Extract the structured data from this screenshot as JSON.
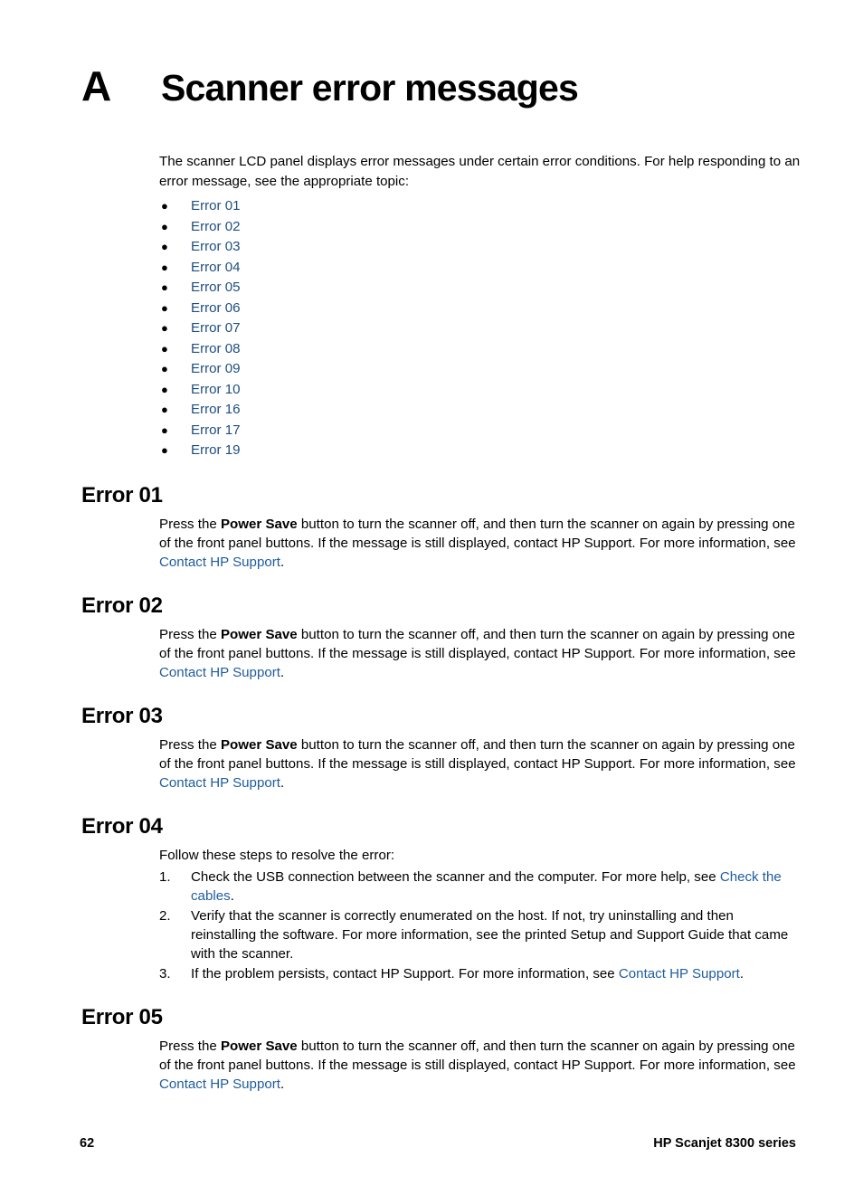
{
  "chapter": {
    "letter": "A",
    "title": "Scanner error messages"
  },
  "intro": "The scanner LCD panel displays error messages under certain error conditions. For help responding to an error message, see the appropriate topic:",
  "toc": {
    "bullet_glyph": "●",
    "items": [
      {
        "label": "Error 01"
      },
      {
        "label": "Error 02"
      },
      {
        "label": "Error 03"
      },
      {
        "label": "Error 04"
      },
      {
        "label": "Error 05"
      },
      {
        "label": "Error 06"
      },
      {
        "label": "Error 07"
      },
      {
        "label": "Error 08"
      },
      {
        "label": "Error 09"
      },
      {
        "label": "Error 10"
      },
      {
        "label": "Error 16"
      },
      {
        "label": "Error 17"
      },
      {
        "label": "Error 19"
      }
    ]
  },
  "sections": [
    {
      "heading": "Error 01",
      "para_lead": "Press the ",
      "para_bold": "Power Save",
      "para_mid": " button to turn the scanner off, and then turn the scanner on again by pressing one of the front panel buttons. If the message is still displayed, contact HP Support. For more information, see ",
      "para_link": "Contact HP Support",
      "para_tail": "."
    },
    {
      "heading": "Error 02",
      "para_lead": "Press the ",
      "para_bold": "Power Save",
      "para_mid": " button to turn the scanner off, and then turn the scanner on again by pressing one of the front panel buttons. If the message is still displayed, contact HP Support. For more information, see ",
      "para_link": "Contact HP Support",
      "para_tail": "."
    },
    {
      "heading": "Error 03",
      "para_lead": "Press the ",
      "para_bold": "Power Save",
      "para_mid": " button to turn the scanner off, and then turn the scanner on again by pressing one of the front panel buttons. If the message is still displayed, contact HP Support. For more information, see ",
      "para_link": "Contact HP Support",
      "para_tail": "."
    },
    {
      "heading": "Error 05",
      "para_lead": "Press the ",
      "para_bold": "Power Save",
      "para_mid": " button to turn the scanner off, and then turn the scanner on again by pressing one of the front panel buttons. If the message is still displayed, contact HP Support. For more information, see ",
      "para_link": "Contact HP Support",
      "para_tail": "."
    }
  ],
  "error04": {
    "heading": "Error 04",
    "lead": "Follow these steps to resolve the error:",
    "steps": [
      {
        "num": "1.",
        "text_before": "Check the USB connection between the scanner and the computer. For more help, see ",
        "link": "Check the cables",
        "text_after": "."
      },
      {
        "num": "2.",
        "text_before": "Verify that the scanner is correctly enumerated on the host. If not, try uninstalling and then reinstalling the software. For more information, see the printed Setup and Support Guide that came with the scanner.",
        "link": "",
        "text_after": ""
      },
      {
        "num": "3.",
        "text_before": "If the problem persists, contact HP Support. For more information, see ",
        "link": "Contact HP Support",
        "text_after": "."
      }
    ]
  },
  "footer": {
    "page_number": "62",
    "product": "HP Scanjet 8300 series"
  },
  "colors": {
    "link": "#1f5c9e",
    "toc_link": "#1d4e80",
    "text": "#000000",
    "background": "#ffffff"
  }
}
